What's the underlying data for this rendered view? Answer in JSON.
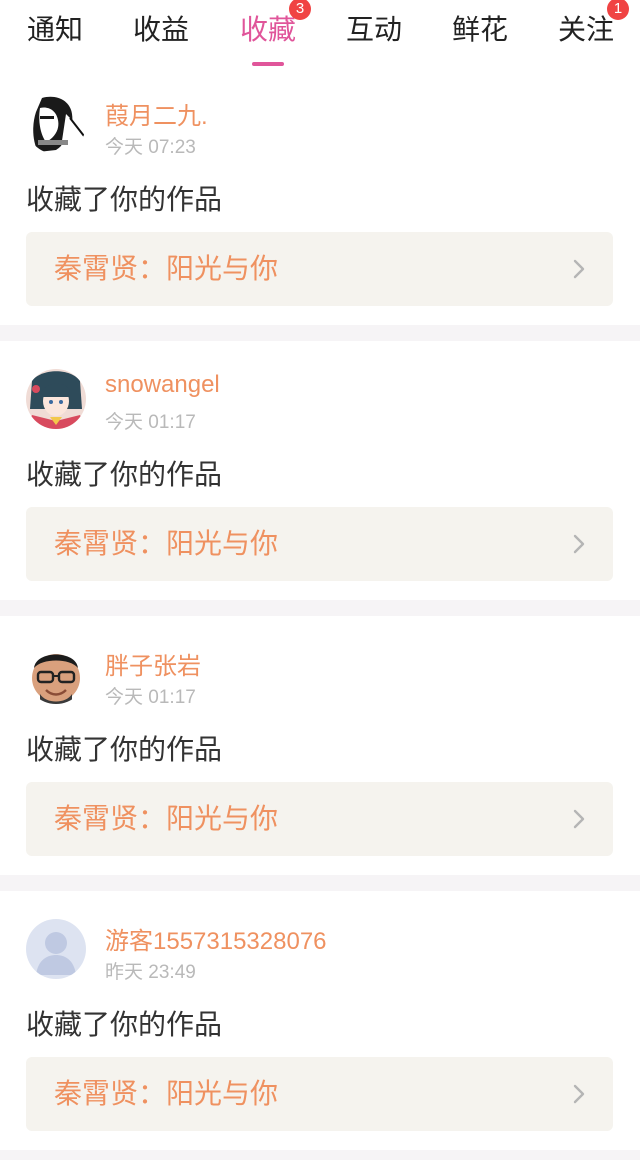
{
  "tabs": [
    {
      "label": "通知",
      "active": false,
      "badge": ""
    },
    {
      "label": "收益",
      "active": false,
      "badge": ""
    },
    {
      "label": "收藏",
      "active": true,
      "badge": "3"
    },
    {
      "label": "互动",
      "active": false,
      "badge": ""
    },
    {
      "label": "鲜花",
      "active": false,
      "badge": ""
    },
    {
      "label": "关注",
      "active": false,
      "badge": "1"
    }
  ],
  "colors": {
    "accent": "#e0559a",
    "username": "#ef9160",
    "badge": "#f04343",
    "card_link_bg": "#f5f3ee"
  },
  "items": [
    {
      "username": "葭月二九.",
      "time": "今天 07:23",
      "action": "收藏了你的作品",
      "work": "秦霄贤：阳光与你",
      "avatar": "sketch-portrait-avatar"
    },
    {
      "username": "snowangel",
      "time": "今天 01:17",
      "action": "收藏了你的作品",
      "work": "秦霄贤：阳光与你",
      "avatar": "anime-girl-avatar"
    },
    {
      "username": "胖子张岩",
      "time": "今天 01:17",
      "action": "收藏了你的作品",
      "work": "秦霄贤：阳光与你",
      "avatar": "man-with-glasses-avatar"
    },
    {
      "username": "游客1557315328076",
      "time": "昨天 23:49",
      "action": "收藏了你的作品",
      "work": "秦霄贤：阳光与你",
      "avatar": "default-user-avatar"
    }
  ]
}
